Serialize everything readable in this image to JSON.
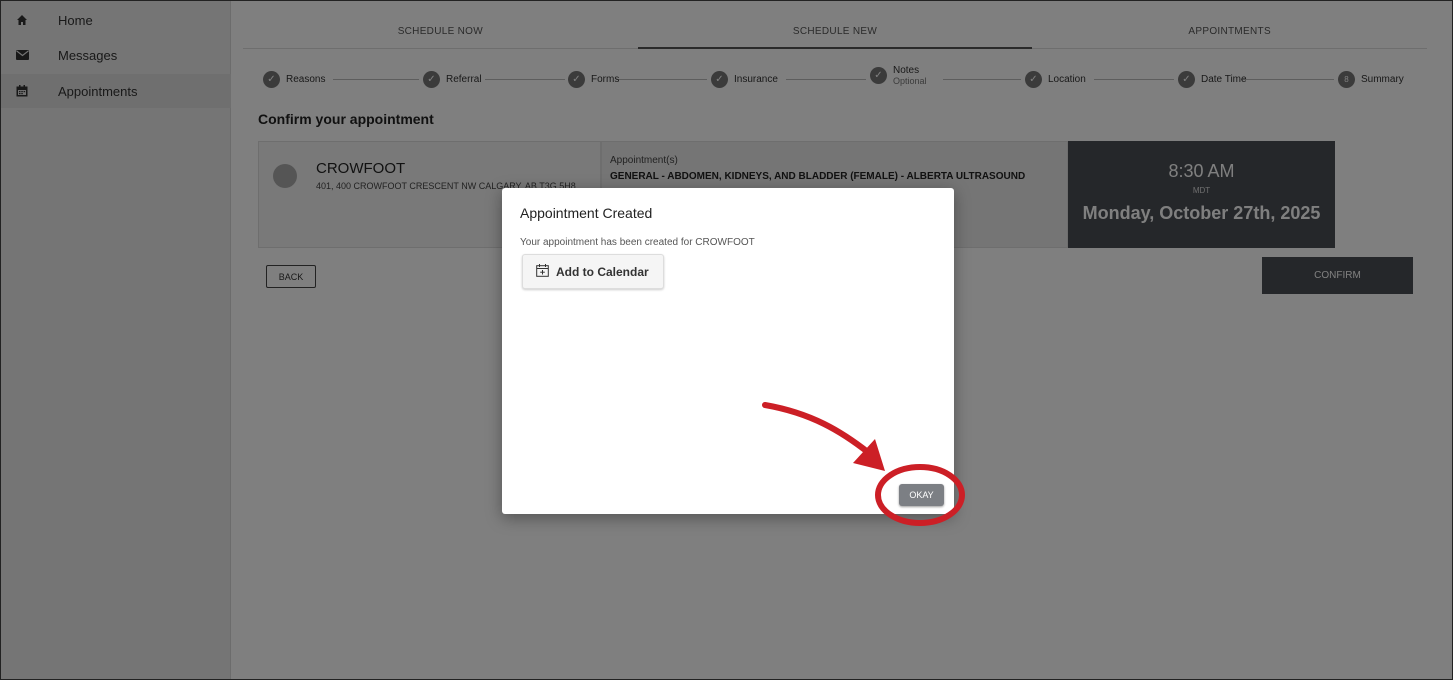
{
  "sidebar": {
    "items": [
      {
        "label": "Home",
        "icon": "home-icon"
      },
      {
        "label": "Messages",
        "icon": "mail-icon"
      },
      {
        "label": "Appointments",
        "icon": "calendar-icon",
        "active": true
      }
    ]
  },
  "tabs": [
    {
      "label": "SCHEDULE NOW"
    },
    {
      "label": "SCHEDULE NEW",
      "active": true
    },
    {
      "label": "APPOINTMENTS"
    }
  ],
  "steps": [
    {
      "label": "Reasons",
      "done": true
    },
    {
      "label": "Referral",
      "done": true
    },
    {
      "label": "Forms",
      "done": true
    },
    {
      "label": "Insurance",
      "done": true
    },
    {
      "label": "Notes",
      "sub": "Optional",
      "done": true
    },
    {
      "label": "Location",
      "done": true
    },
    {
      "label": "Date Time",
      "done": true
    },
    {
      "label": "Summary",
      "number": "8",
      "done": false
    }
  ],
  "confirm": {
    "title": "Confirm your appointment",
    "location_name": "CROWFOOT",
    "location_address": "401, 400 CROWFOOT CRESCENT NW CALGARY, AB T3G 5H8",
    "appointment_label": "Appointment(s)",
    "appointment_name": "GENERAL - ABDOMEN, KIDNEYS, AND BLADDER (FEMALE) - ALBERTA ULTRASOUND",
    "time": "8:30 AM",
    "timezone": "MDT",
    "date": "Monday, October 27th, 2025",
    "back_label": "BACK",
    "confirm_label": "CONFIRM"
  },
  "modal": {
    "title": "Appointment Created",
    "message": "Your appointment has been created for CROWFOOT",
    "calendar_label": "Add to Calendar",
    "okay_label": "OKAY"
  },
  "colors": {
    "dark_card": "#4b4f55",
    "annotation_red": "#cc1f26",
    "step_dot": "#777777"
  }
}
